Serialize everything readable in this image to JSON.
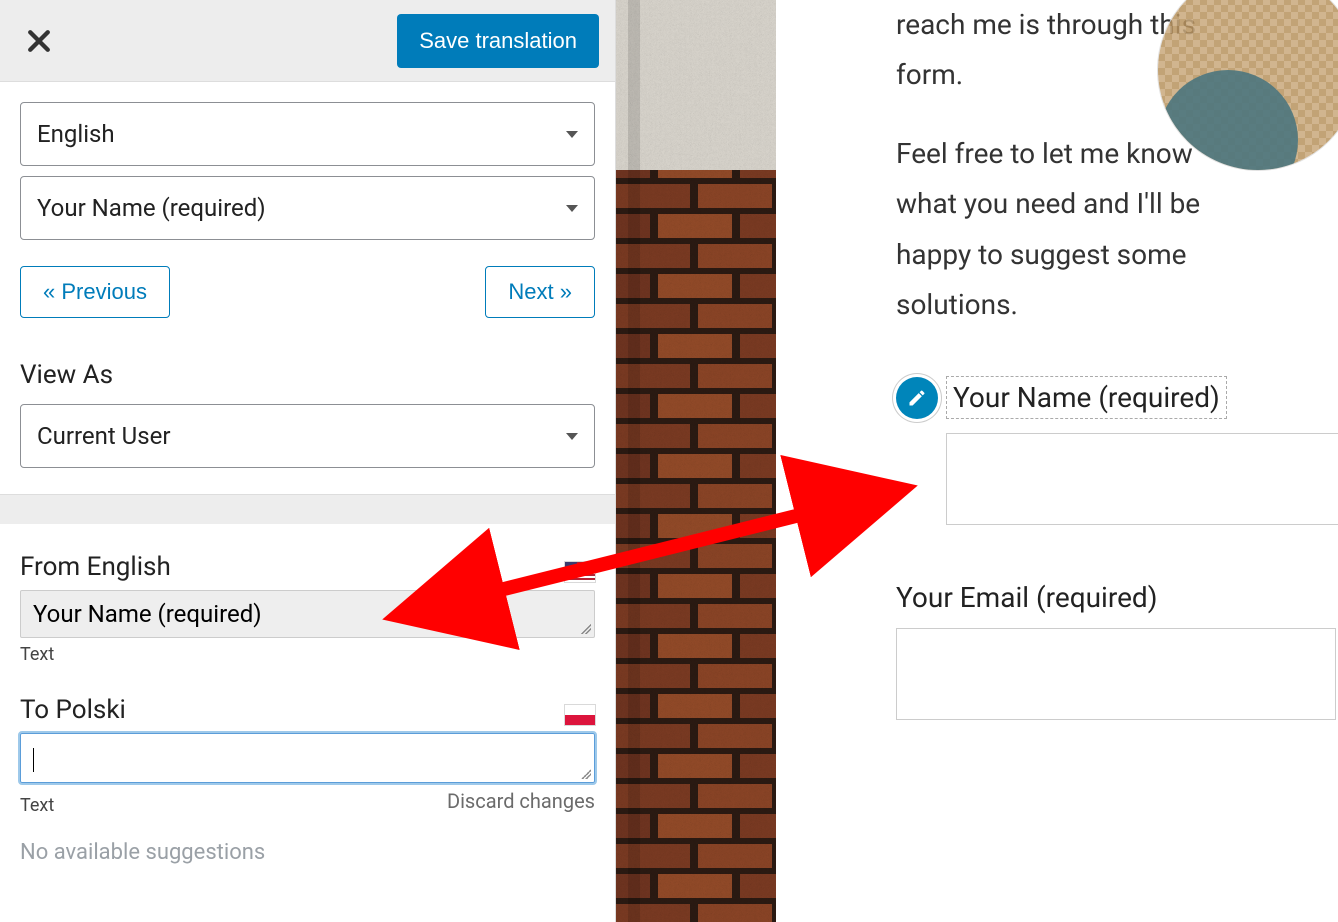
{
  "header": {
    "save_label": "Save translation"
  },
  "selects": {
    "language_label": "English",
    "string_label": "Your Name (required)"
  },
  "nav": {
    "prev_label": "« Previous",
    "next_label": "Next »"
  },
  "view_as": {
    "section_label": "View As",
    "current_label": "Current User"
  },
  "source": {
    "heading": "From English",
    "value": "Your Name (required)",
    "type_label": "Text"
  },
  "target": {
    "heading": "To Polski",
    "value": "",
    "type_label": "Text",
    "discard_label": "Discard changes",
    "no_suggestions": "No available suggestions"
  },
  "preview": {
    "para1": "reach me is through this form.",
    "para2": "Feel free to let me know what you need and I'll be happy to suggest some solutions.",
    "name_field_label": "Your Name (required)",
    "email_field_label": "Your Email (required)"
  }
}
